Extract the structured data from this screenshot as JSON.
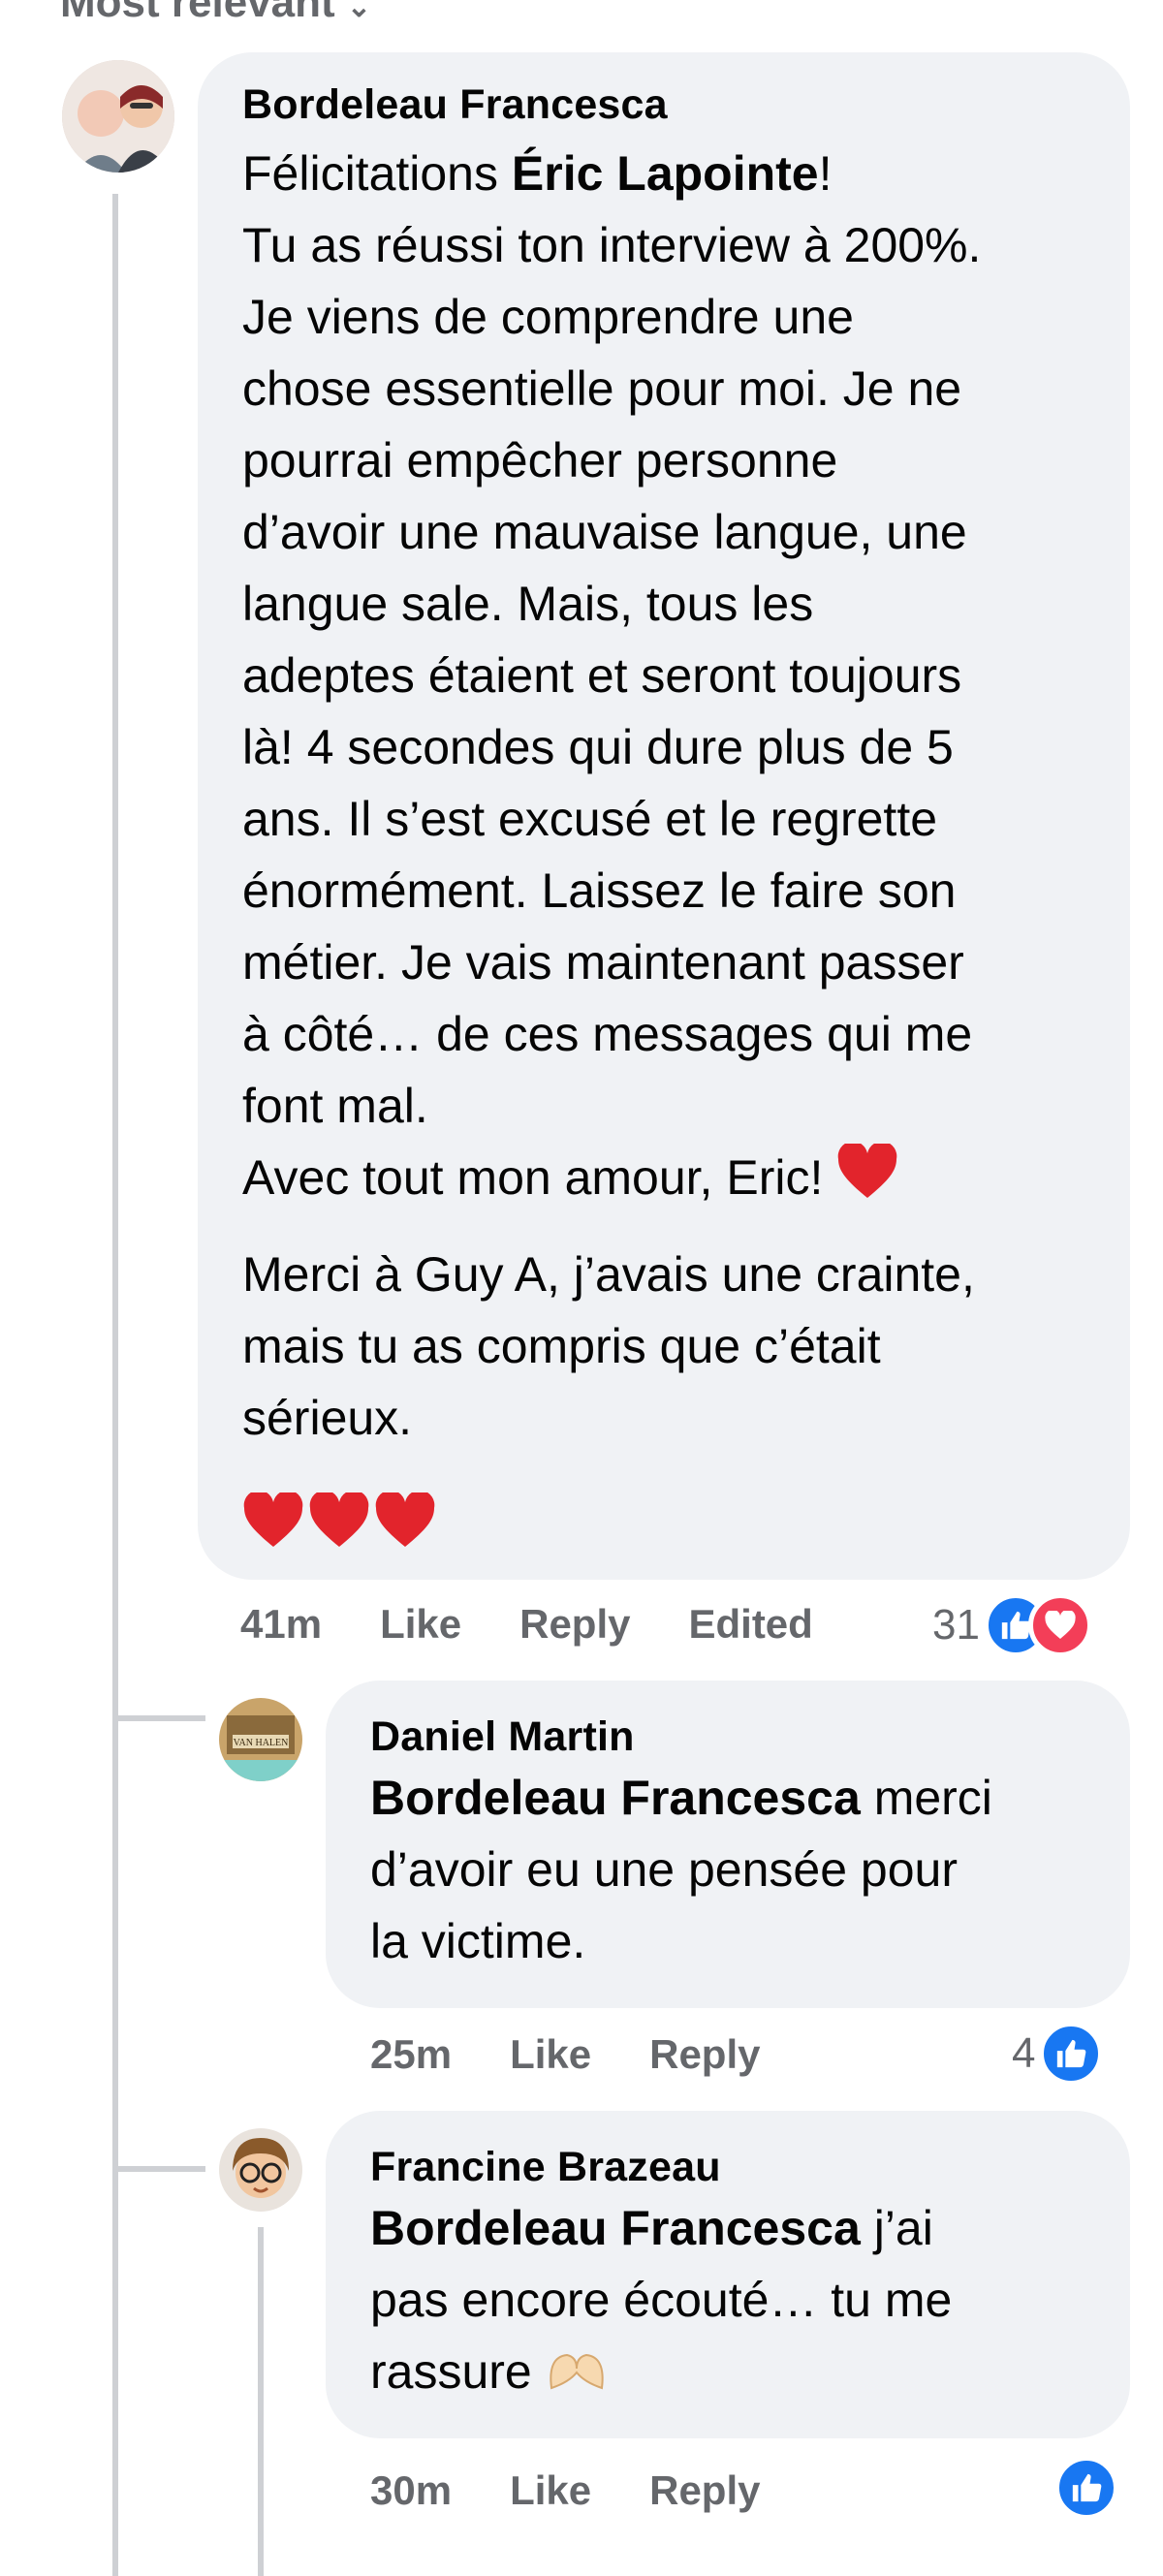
{
  "sort_label": "Most relevant",
  "comment1": {
    "author": "Bordeleau Francesca",
    "lines": [
      {
        "pre": "Félicitations ",
        "bold": "Éric Lapointe",
        "post": "!"
      },
      {
        "text": "Tu as réussi ton interview à 200%."
      },
      {
        "text": "Je viens de comprendre une"
      },
      {
        "text": "chose essentielle pour moi. Je ne"
      },
      {
        "text": "pourrai empêcher personne"
      },
      {
        "text": "d’avoir une mauvaise langue, une"
      },
      {
        "text": "langue sale. Mais, tous les"
      },
      {
        "text": "adeptes étaient et seront toujours"
      },
      {
        "text": "là! 4 secondes qui dure plus de 5"
      },
      {
        "text": "ans. Il s’est excusé et le regrette"
      },
      {
        "text": "énormément. Laissez le faire son"
      },
      {
        "text": "métier. Je vais maintenant passer"
      },
      {
        "text": "à côté… de ces messages qui me"
      },
      {
        "text": "font mal."
      }
    ],
    "love_line": "Avec tout mon amour, Eric! ",
    "para2": [
      "Merci à Guy A, j’avais une crainte,",
      "mais tu as compris que c’était",
      "sérieux."
    ],
    "time": "41m",
    "like": "Like",
    "reply": "Reply",
    "edited": "Edited",
    "reaction_count": "31"
  },
  "reply1": {
    "author": "Daniel Martin",
    "mention": "Bordeleau Francesca",
    "text_first": " merci",
    "lines": [
      "d’avoir eu une pensée pour",
      "la victime."
    ],
    "time": "25m",
    "like": "Like",
    "reply": "Reply",
    "reaction_count": "4"
  },
  "reply2": {
    "author": "Francine Brazeau",
    "mention": "Bordeleau Francesca",
    "text_first": " j’ai",
    "lines": [
      "pas encore écouté… tu me",
      "rassure "
    ],
    "time": "30m",
    "like": "Like",
    "reply": "Reply"
  }
}
